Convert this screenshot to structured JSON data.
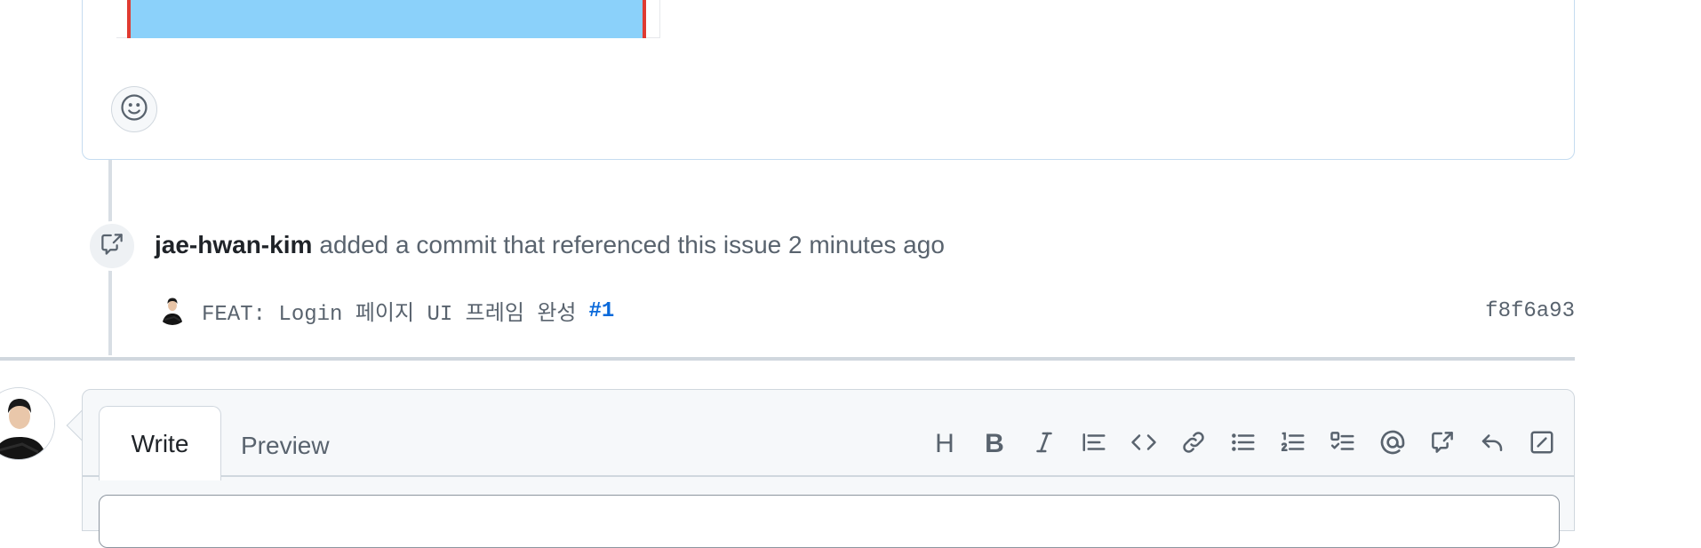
{
  "timeline_event": {
    "author": "jae-hwan-kim",
    "action_text": "added a commit that referenced this issue 2 minutes ago"
  },
  "commit": {
    "message": "FEAT: Login 페이지 UI 프레임 완성",
    "issue_ref": "#1",
    "sha": "f8f6a93"
  },
  "editor": {
    "tabs": {
      "write_label": "Write",
      "preview_label": "Preview"
    },
    "toolbar": {
      "heading_label": "H",
      "bold_label": "B"
    }
  },
  "colors": {
    "link": "#0969da",
    "muted_text": "#59636e",
    "image_fill": "#8bd1fa",
    "image_border": "#e03b32"
  },
  "icons": {
    "reaction": "smiley-icon",
    "event": "cross-reference-icon",
    "toolbar": [
      "heading-icon",
      "bold-icon",
      "italic-icon",
      "quote-icon",
      "code-icon",
      "link-icon",
      "unordered-list-icon",
      "ordered-list-icon",
      "task-list-icon",
      "mention-icon",
      "cross-reference-icon",
      "reply-icon",
      "slash-commands-icon"
    ]
  }
}
